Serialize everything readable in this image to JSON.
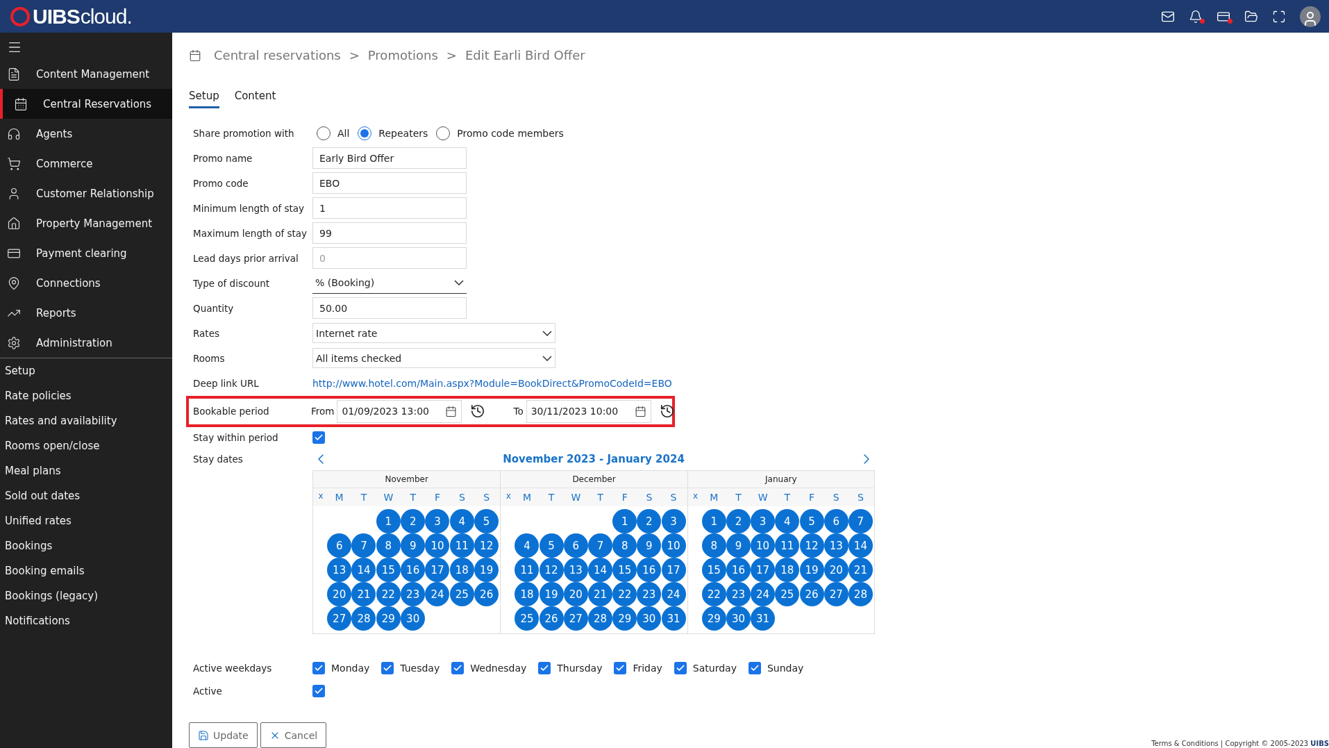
{
  "header": {
    "logo": "UIBS",
    "logo_suffix": "cloud.",
    "icons": [
      {
        "kind": "mail",
        "alert": false
      },
      {
        "kind": "bell",
        "alert": true
      },
      {
        "kind": "card",
        "alert": true
      },
      {
        "kind": "folder",
        "alert": false
      },
      {
        "kind": "expand",
        "alert": false
      },
      {
        "kind": "avatar",
        "alert": false
      }
    ]
  },
  "sidebar": {
    "items": [
      {
        "label": "Content Management",
        "selected": false
      },
      {
        "label": "Central Reservations",
        "selected": true
      },
      {
        "label": "Agents",
        "selected": false
      },
      {
        "label": "Commerce",
        "selected": false
      },
      {
        "label": "Customer Relationship",
        "selected": false
      },
      {
        "label": "Property Management",
        "selected": false
      },
      {
        "label": "Payment clearing",
        "selected": false
      },
      {
        "label": "Connections",
        "selected": false
      },
      {
        "label": "Reports",
        "selected": false
      },
      {
        "label": "Administration",
        "selected": false
      }
    ],
    "subitems": [
      "Setup",
      "Rate policies",
      "Rates and availability",
      "Rooms open/close",
      "Meal plans",
      "Sold out dates",
      "Unified rates",
      "Bookings",
      "Booking emails",
      "Bookings (legacy)",
      "Notifications"
    ]
  },
  "breadcrumb": [
    "Central reservations",
    "Promotions",
    "Edit Earli Bird Offer"
  ],
  "breadcrumb_separator": ">",
  "tabs": [
    {
      "label": "Setup",
      "selected": true
    },
    {
      "label": "Content",
      "selected": false
    }
  ],
  "share": {
    "label": "Share promotion with",
    "options": [
      {
        "label": "All",
        "selected": false
      },
      {
        "label": "Repeaters",
        "selected": true
      },
      {
        "label": "Promo code members",
        "selected": false
      }
    ]
  },
  "fields": [
    {
      "kind": "input",
      "label": "Promo name",
      "value": "Early Bird Offer"
    },
    {
      "kind": "input",
      "label": "Promo code",
      "value": "EBO"
    },
    {
      "kind": "input",
      "label": "Minimum length of stay",
      "value": "1"
    },
    {
      "kind": "input",
      "label": "Maximum length of stay",
      "value": "99"
    },
    {
      "kind": "input",
      "label": "Lead days prior arrival",
      "placeholder": "0"
    },
    {
      "kind": "underline-select",
      "label": "Type of discount",
      "value": "% (Booking)"
    },
    {
      "kind": "input",
      "label": "Quantity",
      "value": "50.00"
    },
    {
      "kind": "select",
      "label": "Rates",
      "value": "Internet rate"
    },
    {
      "kind": "select",
      "label": "Rooms",
      "value": "All items checked"
    },
    {
      "kind": "link",
      "label": "Deep link URL",
      "value": "http://www.hotel.com/Main.aspx?Module=BookDirect&PromoCodeId=EBO"
    }
  ],
  "bookable_period": {
    "label": "Bookable period",
    "highlighted": true,
    "from_label": "From",
    "from": "01/09/2023 13:00",
    "to_label": "To",
    "to": "30/11/2023 10:00"
  },
  "stay_within_period": {
    "label": "Stay within period",
    "checked": true
  },
  "stay_dates": {
    "label": "Stay dates",
    "range_title": "November 2023 - January 2024",
    "months": [
      {
        "name": "November",
        "week_column": "x",
        "weekday_heads": [
          "M",
          "T",
          "W",
          "T",
          "F",
          "S",
          "S"
        ],
        "days_selected": true,
        "weeks": [
          [
            "1",
            "2",
            "3",
            "4",
            "5"
          ],
          [
            "6",
            "7",
            "8",
            "9",
            "10",
            "11",
            "12"
          ],
          [
            "13",
            "14",
            "15",
            "16",
            "17",
            "18",
            "19"
          ],
          [
            "20",
            "21",
            "22",
            "23",
            "24",
            "25",
            "26"
          ],
          [
            "27",
            "28",
            "29",
            "30"
          ]
        ]
      },
      {
        "name": "December",
        "week_column": "x",
        "weekday_heads": [
          "M",
          "T",
          "W",
          "T",
          "F",
          "S",
          "S"
        ],
        "days_selected": true,
        "weeks": [
          [
            "1",
            "2",
            "3"
          ],
          [
            "4",
            "5",
            "6",
            "7",
            "8",
            "9",
            "10"
          ],
          [
            "11",
            "12",
            "13",
            "14",
            "15",
            "16",
            "17"
          ],
          [
            "18",
            "19",
            "20",
            "21",
            "22",
            "23",
            "24"
          ],
          [
            "25",
            "26",
            "27",
            "28",
            "29",
            "30",
            "31"
          ]
        ]
      },
      {
        "name": "January",
        "week_column": "x",
        "weekday_heads": [
          "M",
          "T",
          "W",
          "T",
          "F",
          "S",
          "S"
        ],
        "days_selected": true,
        "weeks": [
          [
            "1",
            "2",
            "3",
            "4",
            "5",
            "6",
            "7"
          ],
          [
            "8",
            "9",
            "10",
            "11",
            "12",
            "13",
            "14"
          ],
          [
            "15",
            "16",
            "17",
            "18",
            "19",
            "20",
            "21"
          ],
          [
            "22",
            "23",
            "24",
            "25",
            "26",
            "27",
            "28"
          ],
          [
            "29",
            "30",
            "31"
          ]
        ]
      }
    ]
  },
  "active_weekdays": {
    "label": "Active weekdays",
    "days": [
      {
        "label": "Monday",
        "checked": true
      },
      {
        "label": "Tuesday",
        "checked": true
      },
      {
        "label": "Wednesday",
        "checked": true
      },
      {
        "label": "Thursday",
        "checked": true
      },
      {
        "label": "Friday",
        "checked": true
      },
      {
        "label": "Saturday",
        "checked": true
      },
      {
        "label": "Sunday",
        "checked": true
      }
    ]
  },
  "active": {
    "label": "Active",
    "checked": true
  },
  "buttons": [
    {
      "kind": "save",
      "label": "Update"
    },
    {
      "kind": "cancel",
      "label": "Cancel"
    }
  ],
  "footer": {
    "text": "Terms & Conditions | Copyright © 2005-2023",
    "brand": "UIBS"
  }
}
